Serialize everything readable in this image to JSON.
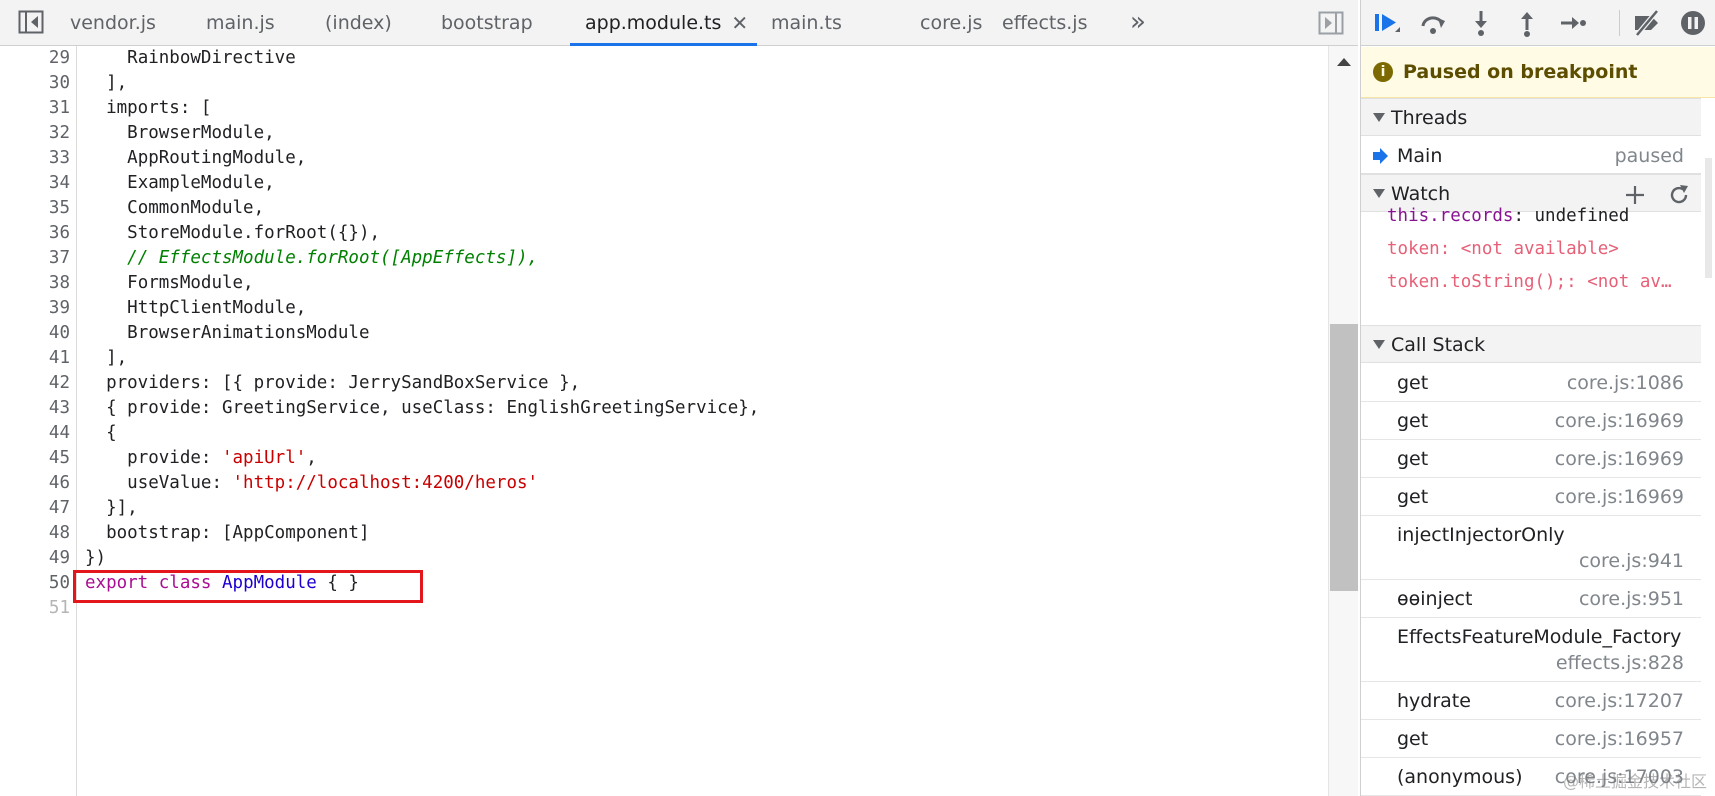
{
  "editor": {
    "tabs": [
      {
        "label": "vendor.js"
      },
      {
        "label": "main.js"
      },
      {
        "label": "(index)"
      },
      {
        "label": "bootstrap"
      },
      {
        "label": "app.module.ts",
        "active": true,
        "closable": true
      },
      {
        "label": "main.ts"
      },
      {
        "label": "core.js"
      },
      {
        "label": "effects.js"
      }
    ],
    "more_tabs": "»",
    "lines": [
      {
        "no": "29",
        "indent": "    ",
        "parts": [
          {
            "t": "RainbowDirective",
            "c": ""
          }
        ]
      },
      {
        "no": "30",
        "indent": "  ",
        "parts": [
          {
            "t": "],",
            "c": ""
          }
        ]
      },
      {
        "no": "31",
        "indent": "  ",
        "parts": [
          {
            "t": "imports: [",
            "c": ""
          }
        ]
      },
      {
        "no": "32",
        "indent": "    ",
        "parts": [
          {
            "t": "BrowserModule,",
            "c": ""
          }
        ]
      },
      {
        "no": "33",
        "indent": "    ",
        "parts": [
          {
            "t": "AppRoutingModule,",
            "c": ""
          }
        ]
      },
      {
        "no": "34",
        "indent": "    ",
        "parts": [
          {
            "t": "ExampleModule,",
            "c": ""
          }
        ]
      },
      {
        "no": "35",
        "indent": "    ",
        "parts": [
          {
            "t": "CommonModule,",
            "c": ""
          }
        ]
      },
      {
        "no": "36",
        "indent": "    ",
        "parts": [
          {
            "t": "StoreModule.forRoot({}),",
            "c": ""
          }
        ]
      },
      {
        "no": "37",
        "indent": "    ",
        "parts": [
          {
            "t": "// EffectsModule.forRoot([AppEffects]),",
            "c": "cmt"
          }
        ]
      },
      {
        "no": "38",
        "indent": "    ",
        "parts": [
          {
            "t": "FormsModule,",
            "c": ""
          }
        ]
      },
      {
        "no": "39",
        "indent": "    ",
        "parts": [
          {
            "t": "HttpClientModule,",
            "c": ""
          }
        ]
      },
      {
        "no": "40",
        "indent": "    ",
        "parts": [
          {
            "t": "BrowserAnimationsModule",
            "c": ""
          }
        ]
      },
      {
        "no": "41",
        "indent": "  ",
        "parts": [
          {
            "t": "],",
            "c": ""
          }
        ]
      },
      {
        "no": "42",
        "indent": "  ",
        "parts": [
          {
            "t": "providers: [{ provide: JerrySandBoxService },",
            "c": ""
          }
        ]
      },
      {
        "no": "43",
        "indent": "  ",
        "parts": [
          {
            "t": "{ provide: GreetingService, useClass: EnglishGreetingService},",
            "c": ""
          }
        ]
      },
      {
        "no": "44",
        "indent": "  ",
        "parts": [
          {
            "t": "{",
            "c": ""
          }
        ]
      },
      {
        "no": "45",
        "indent": "    ",
        "parts": [
          {
            "t": "provide: ",
            "c": ""
          },
          {
            "t": "'apiUrl'",
            "c": "str"
          },
          {
            "t": ",",
            "c": ""
          }
        ]
      },
      {
        "no": "46",
        "indent": "    ",
        "parts": [
          {
            "t": "useValue: ",
            "c": ""
          },
          {
            "t": "'http://localhost:4200/heros'",
            "c": "str"
          }
        ]
      },
      {
        "no": "47",
        "indent": "  ",
        "parts": [
          {
            "t": "}],",
            "c": ""
          }
        ]
      },
      {
        "no": "48",
        "indent": "  ",
        "parts": [
          {
            "t": "bootstrap: [AppComponent]",
            "c": ""
          }
        ]
      },
      {
        "no": "49",
        "indent": "",
        "parts": [
          {
            "t": "})",
            "c": ""
          }
        ]
      },
      {
        "no": "50",
        "indent": "",
        "parts": [
          {
            "t": "export",
            "c": "kw"
          },
          {
            "t": " ",
            "c": ""
          },
          {
            "t": "class",
            "c": "kw"
          },
          {
            "t": " ",
            "c": ""
          },
          {
            "t": "AppModule",
            "c": "cls"
          },
          {
            "t": " { }",
            "c": ""
          }
        ]
      },
      {
        "no": "51",
        "indent": "",
        "parts": [],
        "faint": true
      }
    ]
  },
  "debugger": {
    "paused_message": "Paused on breakpoint",
    "threads": {
      "title": "Threads",
      "items": [
        {
          "name": "Main",
          "status": "paused"
        }
      ]
    },
    "watch": {
      "title": "Watch",
      "items": [
        {
          "name": "this.records",
          "value": ": undefined",
          "unavailable": false
        },
        {
          "name": "token",
          "value": ": <not available>",
          "unavailable": true
        },
        {
          "name": "token.toString();",
          "value": ": <not av…",
          "unavailable": true
        }
      ]
    },
    "call_stack": {
      "title": "Call Stack",
      "frames": [
        {
          "name": "get",
          "location": "core.js:1086"
        },
        {
          "name": "get",
          "location": "core.js:16969"
        },
        {
          "name": "get",
          "location": "core.js:16969"
        },
        {
          "name": "get",
          "location": "core.js:16969"
        },
        {
          "name": "injectInjectorOnly",
          "location": "core.js:941",
          "wrap": true
        },
        {
          "name": "ɵɵinject",
          "location": "core.js:951"
        },
        {
          "name": "EffectsFeatureModule_Factory",
          "location": "effects.js:828",
          "wrap": true
        },
        {
          "name": "hydrate",
          "location": "core.js:17207"
        },
        {
          "name": "get",
          "location": "core.js:16957"
        },
        {
          "name": "(anonymous)",
          "location": "core.js:17003"
        }
      ]
    }
  },
  "watermark": "@稀土掘金技术社区",
  "colors": {
    "accent": "#1a73e8",
    "highlight_box": "#e3161b",
    "string": "#c80000",
    "comment": "#008000",
    "keyword": "#aa0d91"
  }
}
